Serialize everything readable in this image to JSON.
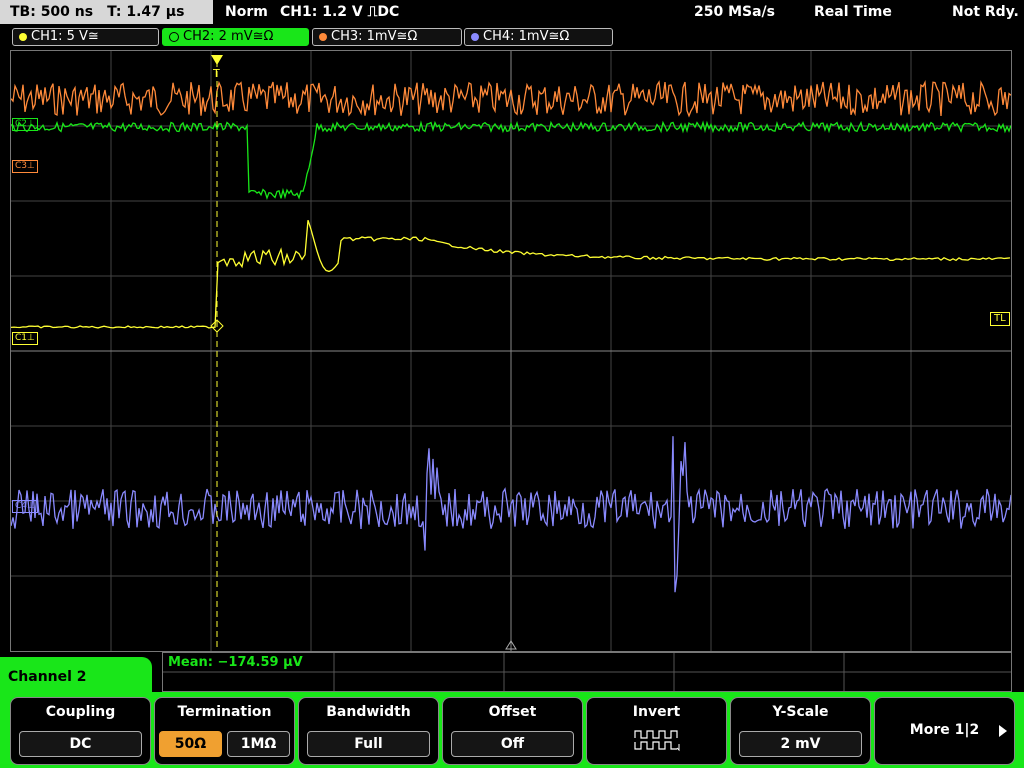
{
  "status_bar": {
    "timebase": "TB: 500 ns",
    "trigger_time": "T: 1.47 µs",
    "trigger_mode": "Norm",
    "trigger_info": "CH1: 1.2 V ⎍DC",
    "sample_rate": "250 MSa/s",
    "acq_mode": "Real Time",
    "ready_state": "Not Rdy."
  },
  "channels": [
    {
      "label": "CH1: 5 V≅",
      "color": "#ffff33"
    },
    {
      "label": "CH2: 2 mV≅Ω",
      "color": "#19e619"
    },
    {
      "label": "CH3: 1mV≅Ω",
      "color": "#ff8a3a"
    },
    {
      "label": "CH4: 1mV≅Ω",
      "color": "#8a8aff"
    }
  ],
  "markers": {
    "c3": "C3⊥",
    "c1": "C1⊥",
    "c2": "C2⊥",
    "c4": "C4⊥",
    "trigger_level": "TL"
  },
  "measurement": {
    "mean": "Mean: −174.59 µV"
  },
  "menu": {
    "title": "Channel 2",
    "keys": [
      {
        "title": "Coupling",
        "value": "DC"
      },
      {
        "title": "Termination",
        "value_a": "50Ω",
        "value_b": "1MΩ"
      },
      {
        "title": "Bandwidth",
        "value": "Full"
      },
      {
        "title": "Offset",
        "value": "Off"
      },
      {
        "title": "Invert"
      },
      {
        "title": "Y-Scale",
        "value": "2 mV"
      },
      {
        "title": "More 1|2"
      }
    ]
  },
  "colors": {
    "accent": "#19e619",
    "ch1": "#ffff33",
    "ch3": "#ff8a3a",
    "ch4": "#8a8aff",
    "selected": "#f0a030"
  }
}
